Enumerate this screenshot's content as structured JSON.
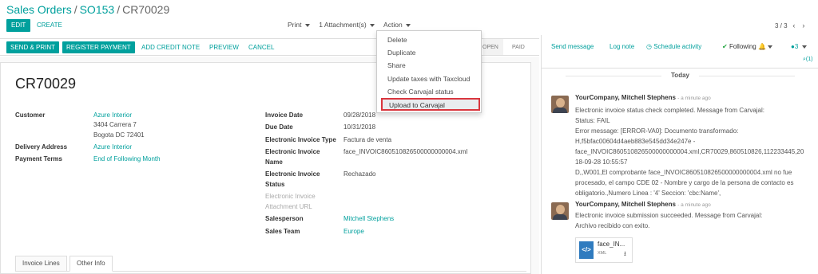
{
  "breadcrumb": {
    "root": "Sales Orders",
    "sep": "/",
    "order": "SO153",
    "current": "CR70029"
  },
  "control": {
    "edit": "EDIT",
    "create": "CREATE",
    "print": "Print",
    "attachments": "1 Attachment(s)",
    "action": "Action",
    "pager": "3 / 3"
  },
  "action_menu": [
    "Delete",
    "Duplicate",
    "Share",
    "Update taxes with Taxcloud",
    "Check Carvajal status",
    "Upload to Carvajal"
  ],
  "statusbar": {
    "send_print": "SEND & PRINT",
    "register_payment": "REGISTER PAYMENT",
    "add_credit_note": "ADD CREDIT NOTE",
    "preview": "PREVIEW",
    "cancel": "CANCEL",
    "stage_open": "OPEN",
    "stage_paid": "PAID"
  },
  "invoice": {
    "name": "CR70029",
    "customer_label": "Customer",
    "customer": "Azure Interior",
    "address1": "3404 Carrera 7",
    "address2": "Bogota DC 72401",
    "delivery_label": "Delivery Address",
    "delivery": "Azure Interior",
    "terms_label": "Payment Terms",
    "terms": "End of Following Month",
    "date_label": "Invoice Date",
    "date": "09/28/2018",
    "due_label": "Due Date",
    "due": "10/31/2018",
    "etype_label": "Electronic Invoice Type",
    "etype": "Factura de venta",
    "ename_label1": "Electronic Invoice",
    "ename_label2": "Name",
    "ename": "face_INVOIC860510826500000000004.xml",
    "estatus_label1": "Electronic Invoice",
    "estatus_label2": "Status",
    "estatus": "Rechazado",
    "eurl_label1": "Electronic Invoice",
    "eurl_label2": "Attachment URL",
    "salesperson_label": "Salesperson",
    "salesperson": "Mitchell Stephens",
    "team_label": "Sales Team",
    "team": "Europe"
  },
  "tabs": {
    "lines": "Invoice Lines",
    "other": "Other Info"
  },
  "chatter": {
    "send_message": "Send message",
    "log_note": "Log note",
    "schedule": "Schedule activity",
    "following": "Following",
    "followers": "3",
    "attachments_count": "(1)",
    "today": "Today",
    "messages": [
      {
        "author": "YourCompany, Mitchell Stephens",
        "ago": "- a minute ago",
        "lines": [
          "Electronic invoice status check completed. Message from Carvajal:",
          "Status: FAIL",
          "Error message: [ERROR-VA0]: Documento transformado:",
          "H,f5bfac00604d4aeb883e545dd34e247e -",
          "face_INVOIC860510826500000000004.xml,CR70029,860510826,112233445,20",
          "18-09-28 10:55:57",
          "D,,W001,El comprobante face_INVOIC860510826500000000004.xml no fue",
          "procesado, el campo CDE 02 - Nombre y cargo de la persona de contacto es",
          "obligatorio.,Numero Linea : '4' Seccion: 'cbc:Name',"
        ]
      },
      {
        "author": "YourCompany, Mitchell Stephens",
        "ago": "- a minute ago",
        "lines": [
          "Electronic invoice submission succeeded. Message from Carvajal:",
          "Archivo recibido con exito."
        ],
        "attachment_name": "face_IN...",
        "attachment_type": "XML"
      }
    ]
  }
}
